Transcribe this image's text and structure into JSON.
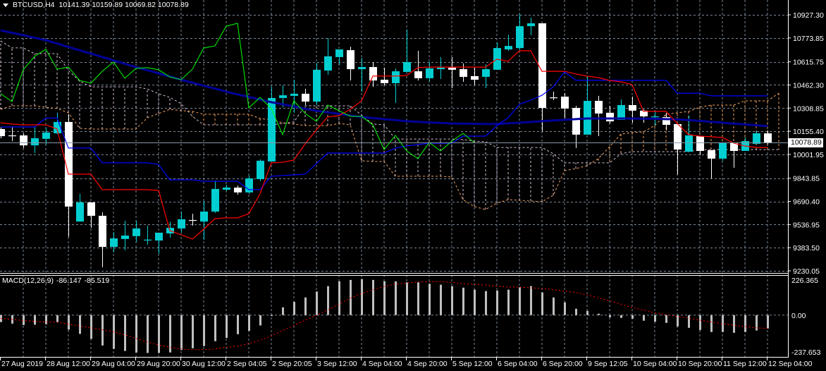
{
  "header": {
    "symbol": "BTCUSD,H4",
    "open": "10141.39",
    "high": "10159.89",
    "low": "10069.82",
    "close": "10078.89",
    "menu_icon": "triangle-down-icon"
  },
  "macd_header": {
    "label": "MACD(12,26,9)",
    "main": "-86.147",
    "signal": "-85.519"
  },
  "current_price_label": "10078.89",
  "colors": {
    "background": "#000000",
    "bull_candle": "#00CED1",
    "bear_candle": "#FFFFFF",
    "grid": "#7A8899",
    "tenkan": "#FF0000",
    "kijun": "#0000FF",
    "chikou": "#00FF00",
    "senkou_a": "#F4A460",
    "senkou_b": "#D8BFD8",
    "moving_average": "#000099",
    "macd_histogram": "#C0C0C0",
    "macd_signal": "#FF0000",
    "current_price_line": "#8899AA"
  },
  "chart_data": {
    "type": "candlestick",
    "symbol": "BTCUSD",
    "timeframe": "H4",
    "grid": true,
    "price_axis": {
      "range": [
        9230.05,
        10927.3
      ],
      "tick_labels": [
        "10927.30",
        "10773.85",
        "10615.75",
        "10462.30",
        "10308.85",
        "10155.40",
        "10001.95",
        "9843.85",
        "9690.40",
        "9536.95",
        "9383.50",
        "9230.05"
      ]
    },
    "time_labels": [
      "27 Aug 2019",
      "28 Aug 12:00",
      "29 Aug 04:00",
      "29 Aug 20:00",
      "30 Aug 12:00",
      "2 Sep 04:05",
      "2 Sep 20:05",
      "3 Sep 12:00",
      "4 Sep 04:00",
      "4 Sep 20:00",
      "5 Sep 12:00",
      "6 Sep 04:00",
      "6 Sep 20:00",
      "9 Sep 12:05",
      "10 Sep 04:00",
      "10 Sep 20:00",
      "11 Sep 12:00",
      "12 Sep 04:00"
    ],
    "ohlc": [
      [
        10170,
        10184,
        10109,
        10123
      ],
      [
        10128,
        10184,
        10090,
        10127
      ],
      [
        10128,
        10142,
        10044,
        10062
      ],
      [
        10062,
        10184,
        10011,
        10109
      ],
      [
        10105,
        10175,
        10067,
        10147
      ],
      [
        10142,
        10278,
        10137,
        10217
      ],
      [
        10217,
        10268,
        9455,
        9656
      ],
      [
        9557,
        9740,
        9557,
        9684
      ],
      [
        9684,
        9684,
        9515,
        9595
      ],
      [
        9595,
        9618,
        9254,
        9389
      ],
      [
        9389,
        9487,
        9352,
        9445
      ],
      [
        9441,
        9562,
        9366,
        9464
      ],
      [
        9460,
        9562,
        9422,
        9511
      ],
      [
        9436,
        9530,
        9403,
        9437
      ],
      [
        9431,
        9483,
        9343,
        9483
      ],
      [
        9478,
        9557,
        9450,
        9515
      ],
      [
        9511,
        9623,
        9483,
        9572
      ],
      [
        9567,
        9609,
        9530,
        9566
      ],
      [
        9557,
        9693,
        9436,
        9623
      ],
      [
        9623,
        9829,
        9614,
        9773
      ],
      [
        9768,
        9801,
        9759,
        9782
      ],
      [
        9782,
        9796,
        9735,
        9750
      ],
      [
        9750,
        9862,
        9740,
        9843
      ],
      [
        9838,
        9969,
        9824,
        9960
      ],
      [
        9955,
        10451,
        9955,
        10376
      ],
      [
        10376,
        10460,
        10315,
        10394
      ],
      [
        10390,
        10497,
        10278,
        10404
      ],
      [
        10404,
        10437,
        10329,
        10352
      ],
      [
        10352,
        10609,
        10329,
        10563
      ],
      [
        10558,
        10773,
        10530,
        10652
      ],
      [
        10647,
        10698,
        10595,
        10698
      ],
      [
        10693,
        10716,
        10492,
        10567
      ],
      [
        10567,
        10642,
        10417,
        10581
      ],
      [
        10581,
        10614,
        10450,
        10492
      ],
      [
        10497,
        10577,
        10460,
        10474
      ],
      [
        10474,
        10572,
        10343,
        10553
      ],
      [
        10549,
        10829,
        10549,
        10614
      ],
      [
        10553,
        10689,
        10492,
        10507
      ],
      [
        10507,
        10614,
        10488,
        10572
      ],
      [
        10567,
        10647,
        10502,
        10577
      ],
      [
        10577,
        10647,
        10441,
        10563
      ],
      [
        10567,
        10605,
        10483,
        10516
      ],
      [
        10521,
        10577,
        10464,
        10497
      ],
      [
        10516,
        10600,
        10441,
        10567
      ],
      [
        10563,
        10745,
        10563,
        10707
      ],
      [
        10698,
        10796,
        10689,
        10721
      ],
      [
        10707,
        10932,
        10689,
        10852
      ],
      [
        10852,
        10909,
        10792,
        10871
      ],
      [
        10871,
        10871,
        10156,
        10310
      ],
      [
        10380,
        10418,
        10362,
        10380
      ],
      [
        10385,
        10408,
        10240,
        10306
      ],
      [
        10310,
        10324,
        10044,
        10133
      ],
      [
        10133,
        10521,
        10133,
        10357
      ],
      [
        10357,
        10390,
        10123,
        10273
      ],
      [
        10278,
        10324,
        10207,
        10221
      ],
      [
        10231,
        10366,
        10231,
        10329
      ],
      [
        10329,
        10385,
        10212,
        10292
      ],
      [
        10292,
        10301,
        10212,
        10254
      ],
      [
        10249,
        10287,
        10193,
        10254
      ],
      [
        10249,
        10278,
        10161,
        10198
      ],
      [
        10203,
        10203,
        9869,
        10034
      ],
      [
        10020,
        10259,
        10020,
        10128
      ],
      [
        10123,
        10123,
        9997,
        10025
      ],
      [
        10030,
        10030,
        9843,
        9974
      ],
      [
        9974,
        10081,
        9960,
        10081
      ],
      [
        10081,
        10081,
        9913,
        10025
      ],
      [
        10025,
        10114,
        10025,
        10090
      ],
      [
        10072,
        10156,
        10072,
        10142
      ],
      [
        10141.39,
        10159.89,
        10069.82,
        10078.89
      ]
    ],
    "current_price": 10078.89,
    "ichimoku": {
      "tenkan": [
        10212,
        10203,
        10198,
        10198,
        10198,
        10170,
        9871,
        9871,
        9871,
        9768,
        9768,
        9768,
        9768,
        9768,
        9763,
        9497,
        9469,
        9441,
        9506,
        9576,
        9581,
        9581,
        9609,
        9740,
        9946,
        9950,
        9964,
        10072,
        10165,
        10250,
        10259,
        10301,
        10357,
        10521,
        10521,
        10521,
        10525,
        10577,
        10581,
        10581,
        10581,
        10581,
        10581,
        10581,
        10633,
        10619,
        10689,
        10689,
        10553,
        10553,
        10553,
        10535,
        10521,
        10511,
        10492,
        10483,
        10464,
        10287,
        10287,
        10287,
        10207,
        10133,
        10123,
        10119,
        10114,
        10077,
        10058,
        10048,
        10048
      ],
      "kijun": [
        10184,
        10184,
        10184,
        10184,
        10243,
        10243,
        10044,
        10044,
        10044,
        9946,
        9946,
        9946,
        9946,
        9946,
        9936,
        9833,
        9833,
        9833,
        9824,
        9824,
        9824,
        9824,
        9768,
        9768,
        9857,
        9862,
        9866,
        9871,
        9941,
        10011,
        10011,
        10011,
        10011,
        10011,
        10011,
        10044,
        10058,
        10067,
        10076,
        10076,
        10076,
        10123,
        10123,
        10123,
        10193,
        10245,
        10334,
        10362,
        10394,
        10450,
        10549,
        10493,
        10493,
        10493,
        10493,
        10493,
        10493,
        10493,
        10493,
        10493,
        10408,
        10408,
        10408,
        10390,
        10390,
        10390,
        10390,
        10390,
        10390
      ],
      "senkou_a": [
        10301,
        10324,
        10324,
        10324,
        10315,
        10306,
        10278,
        10175,
        10170,
        10170,
        10170,
        10170,
        10170,
        10245,
        10273,
        10301,
        10292,
        10287,
        10268,
        10268,
        10268,
        10268,
        10268,
        10240,
        10231,
        10212,
        10203,
        10193,
        10193,
        10193,
        10207,
        10198,
        9960,
        9955,
        9955,
        9857,
        9857,
        9857,
        9857,
        9857,
        9852,
        9702,
        9656,
        9637,
        9679,
        9702,
        9698,
        9693,
        9688,
        9731,
        9894,
        9908,
        9927,
        9974,
        10053,
        10137,
        10147,
        10151,
        10193,
        10268,
        10278,
        10287,
        10315,
        10329,
        10329,
        10329,
        10357,
        10357,
        10357,
        10408
      ],
      "senkou_b": [
        10754,
        10708,
        10708,
        10670,
        10670,
        10670,
        10558,
        10488,
        10450,
        10450,
        10450,
        10450,
        10450,
        10436,
        10404,
        10380,
        10338,
        10254,
        10198,
        10198,
        10198,
        10198,
        10198,
        10198,
        10198,
        10207,
        10217,
        10324,
        10324,
        10324,
        10324,
        10324,
        10263,
        10203,
        10198,
        10104,
        10104,
        10104,
        10104,
        10104,
        10104,
        10100,
        10090,
        10086,
        10048,
        10048,
        10048,
        10048,
        10048,
        10006,
        9946,
        9946,
        9946,
        9946,
        9946,
        10006,
        10020,
        10020,
        10020,
        10020,
        10020,
        10020,
        10034,
        10034,
        10034,
        10034,
        10034,
        10034,
        10034,
        10034
      ],
      "chikou_shift": 26
    },
    "moving_average": [
      10824,
      10808,
      10792,
      10775,
      10759,
      10737,
      10714,
      10692,
      10670,
      10648,
      10625,
      10603,
      10581,
      10560,
      10539,
      10518,
      10497,
      10477,
      10457,
      10438,
      10418,
      10400,
      10383,
      10365,
      10348,
      10334,
      10320,
      10305,
      10291,
      10281,
      10271,
      10260,
      10250,
      10243,
      10236,
      10229,
      10222,
      10218,
      10214,
      10211,
      10207,
      10206,
      10205,
      10204,
      10203,
      10208,
      10212,
      10217,
      10222,
      10227,
      10231,
      10236,
      10240,
      10240,
      10240,
      10240,
      10240,
      10239,
      10238,
      10236,
      10235,
      10229,
      10224,
      10218,
      10212,
      10206,
      10201,
      10195,
      10189
    ],
    "macd": {
      "axis_range": [
        -237.653,
        226.365
      ],
      "tick_labels": [
        "226.365",
        "0.00",
        "-237.653"
      ],
      "histogram": [
        -45,
        -55,
        -64,
        -62,
        -59,
        -45,
        -94,
        -121,
        -153,
        -196,
        -218,
        -231,
        -241,
        -244,
        -244,
        -241,
        -226,
        -214,
        -200,
        -168,
        -147,
        -123,
        -101,
        -67,
        -6,
        50,
        85,
        114,
        152,
        187,
        218,
        227,
        233,
        227,
        218,
        218,
        211,
        211,
        202,
        196,
        187,
        177,
        164,
        155,
        159,
        164,
        179,
        187,
        146,
        114,
        82,
        41,
        27,
        9,
        -14,
        -18,
        -23,
        -36,
        -42,
        -50,
        -73,
        -82,
        -96,
        -109,
        -109,
        -114,
        -109,
        -99,
        -86.147
      ],
      "signal": [
        -21,
        -28,
        -35,
        -40,
        -45,
        -45,
        -59,
        -70,
        -82,
        -94,
        -108,
        -127,
        -150,
        -173,
        -193,
        -207,
        -218,
        -223,
        -223,
        -218,
        -208,
        -200,
        -184,
        -162,
        -134,
        -101,
        -67,
        -33,
        -1,
        33,
        71,
        109,
        139,
        162,
        185,
        200,
        207,
        214,
        215,
        216,
        211,
        203,
        199,
        193,
        187,
        181,
        181,
        176,
        172,
        164,
        155,
        146,
        131,
        111,
        93,
        71,
        48,
        33,
        15,
        3,
        -9,
        -18,
        -33,
        -44,
        -56,
        -65,
        -74,
        -82,
        -85.519
      ]
    }
  }
}
